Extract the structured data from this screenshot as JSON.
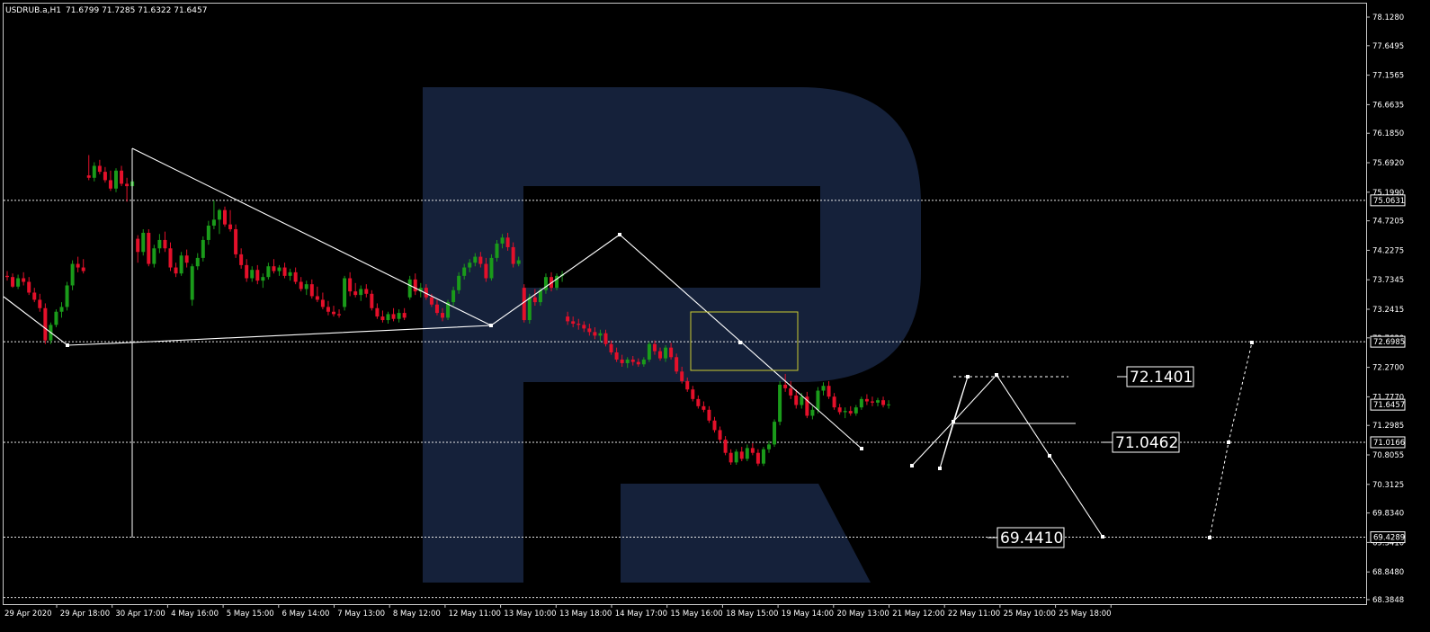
{
  "header": {
    "symbol": "USDRUB.a,H1",
    "ohlc": "71.6799 71.7285 71.6322 71.6457"
  },
  "colors": {
    "background": "#000000",
    "bull": "#1a9b1a",
    "bear": "#e4102a",
    "wave": "#ffffff",
    "zone": "#cccc33",
    "logo": "#15213a"
  },
  "chart_data": {
    "type": "candlestick",
    "symbol": "USDRUB.a",
    "timeframe": "H1",
    "grid": false,
    "ylim": [
      68.3848,
      78.128
    ],
    "y_ticks": [
      "78.1280",
      "77.6495",
      "77.1565",
      "76.6635",
      "76.1850",
      "75.6920",
      "75.1990",
      "74.7205",
      "74.2275",
      "73.7345",
      "73.2415",
      "72.7630",
      "72.2700",
      "71.7770",
      "71.2985",
      "70.8055",
      "70.3125",
      "69.8340",
      "69.3410",
      "68.8480",
      "68.3848"
    ],
    "x_ticks": [
      "29 Apr 2020",
      "29 Apr 18:00",
      "30 Apr 17:00",
      "4 May 16:00",
      "5 May 15:00",
      "6 May 14:00",
      "7 May 13:00",
      "8 May 12:00",
      "12 May 11:00",
      "13 May 10:00",
      "13 May 18:00",
      "14 May 17:00",
      "15 May 16:00",
      "18 May 15:00",
      "19 May 14:00",
      "20 May 13:00",
      "21 May 12:00",
      "22 May 11:00",
      "25 May 10:00",
      "25 May 18:00"
    ],
    "highlight_levels": [
      "75.0631",
      "72.6985",
      "71.6457",
      "71.0166",
      "69.4289"
    ],
    "targets": [
      "72.1401",
      "71.0462",
      "69.4410"
    ],
    "candles": [
      {
        "o": 73.8,
        "h": 73.88,
        "l": 73.72,
        "c": 73.78
      },
      {
        "o": 73.78,
        "h": 73.84,
        "l": 73.6,
        "c": 73.62
      },
      {
        "o": 73.62,
        "h": 73.82,
        "l": 73.58,
        "c": 73.76
      },
      {
        "o": 73.76,
        "h": 73.86,
        "l": 73.64,
        "c": 73.7
      },
      {
        "o": 73.7,
        "h": 73.78,
        "l": 73.48,
        "c": 73.52
      },
      {
        "o": 73.52,
        "h": 73.6,
        "l": 73.36,
        "c": 73.4
      },
      {
        "o": 73.4,
        "h": 73.5,
        "l": 73.2,
        "c": 73.26
      },
      {
        "o": 73.26,
        "h": 73.34,
        "l": 72.66,
        "c": 72.72
      },
      {
        "o": 72.72,
        "h": 73.02,
        "l": 72.66,
        "c": 72.98
      },
      {
        "o": 72.98,
        "h": 73.24,
        "l": 72.94,
        "c": 73.2
      },
      {
        "o": 73.2,
        "h": 73.36,
        "l": 73.1,
        "c": 73.28
      },
      {
        "o": 73.28,
        "h": 73.7,
        "l": 73.22,
        "c": 73.64
      },
      {
        "o": 73.64,
        "h": 74.06,
        "l": 73.56,
        "c": 74.0
      },
      {
        "o": 74.0,
        "h": 74.12,
        "l": 73.86,
        "c": 73.94
      },
      {
        "o": 73.94,
        "h": 74.08,
        "l": 73.84,
        "c": 73.88
      },
      {
        "o": 75.48,
        "h": 75.82,
        "l": 75.4,
        "c": 75.44
      },
      {
        "o": 75.44,
        "h": 75.7,
        "l": 75.38,
        "c": 75.64
      },
      {
        "o": 75.64,
        "h": 75.74,
        "l": 75.5,
        "c": 75.54
      },
      {
        "o": 75.54,
        "h": 75.62,
        "l": 75.36,
        "c": 75.4
      },
      {
        "o": 75.4,
        "h": 75.56,
        "l": 75.22,
        "c": 75.26
      },
      {
        "o": 75.26,
        "h": 75.6,
        "l": 75.2,
        "c": 75.56
      },
      {
        "o": 75.56,
        "h": 75.64,
        "l": 75.3,
        "c": 75.34
      },
      {
        "o": 75.34,
        "h": 75.44,
        "l": 75.04,
        "c": 75.3
      },
      {
        "o": 75.3,
        "h": 75.42,
        "l": 75.24,
        "c": 75.38
      },
      {
        "o": 74.42,
        "h": 74.48,
        "l": 74.02,
        "c": 74.2
      },
      {
        "o": 74.2,
        "h": 74.58,
        "l": 74.14,
        "c": 74.52
      },
      {
        "o": 74.52,
        "h": 74.58,
        "l": 73.96,
        "c": 74.0
      },
      {
        "o": 74.0,
        "h": 74.32,
        "l": 73.94,
        "c": 74.26
      },
      {
        "o": 74.26,
        "h": 74.5,
        "l": 74.18,
        "c": 74.4
      },
      {
        "o": 74.4,
        "h": 74.54,
        "l": 74.2,
        "c": 74.26
      },
      {
        "o": 74.26,
        "h": 74.36,
        "l": 73.88,
        "c": 73.94
      },
      {
        "o": 73.94,
        "h": 74.02,
        "l": 73.78,
        "c": 73.84
      },
      {
        "o": 73.84,
        "h": 74.2,
        "l": 73.8,
        "c": 74.14
      },
      {
        "o": 74.14,
        "h": 74.24,
        "l": 73.94,
        "c": 74.02
      },
      {
        "o": 73.4,
        "h": 74.0,
        "l": 73.3,
        "c": 73.96
      },
      {
        "o": 73.96,
        "h": 74.18,
        "l": 73.9,
        "c": 74.1
      },
      {
        "o": 74.1,
        "h": 74.46,
        "l": 74.04,
        "c": 74.4
      },
      {
        "o": 74.4,
        "h": 74.72,
        "l": 74.32,
        "c": 74.64
      },
      {
        "o": 74.64,
        "h": 75.06,
        "l": 74.58,
        "c": 74.74
      },
      {
        "o": 74.74,
        "h": 74.92,
        "l": 74.5,
        "c": 74.9
      },
      {
        "o": 74.9,
        "h": 74.96,
        "l": 74.62,
        "c": 74.66
      },
      {
        "o": 74.66,
        "h": 74.9,
        "l": 74.54,
        "c": 74.58
      },
      {
        "o": 74.58,
        "h": 74.66,
        "l": 74.1,
        "c": 74.16
      },
      {
        "o": 74.16,
        "h": 74.26,
        "l": 73.92,
        "c": 73.98
      },
      {
        "o": 73.98,
        "h": 74.08,
        "l": 73.7,
        "c": 73.76
      },
      {
        "o": 73.76,
        "h": 73.96,
        "l": 73.7,
        "c": 73.9
      },
      {
        "o": 73.9,
        "h": 73.98,
        "l": 73.66,
        "c": 73.72
      },
      {
        "o": 73.72,
        "h": 73.84,
        "l": 73.6,
        "c": 73.78
      },
      {
        "o": 73.78,
        "h": 74.02,
        "l": 73.74,
        "c": 73.96
      },
      {
        "o": 73.96,
        "h": 74.08,
        "l": 73.84,
        "c": 73.88
      },
      {
        "o": 73.88,
        "h": 73.98,
        "l": 73.8,
        "c": 73.94
      },
      {
        "o": 73.94,
        "h": 74.02,
        "l": 73.76,
        "c": 73.8
      },
      {
        "o": 73.8,
        "h": 73.92,
        "l": 73.72,
        "c": 73.86
      },
      {
        "o": 73.86,
        "h": 73.94,
        "l": 73.66,
        "c": 73.7
      },
      {
        "o": 73.7,
        "h": 73.78,
        "l": 73.54,
        "c": 73.58
      },
      {
        "o": 73.58,
        "h": 73.72,
        "l": 73.48,
        "c": 73.66
      },
      {
        "o": 73.66,
        "h": 73.74,
        "l": 73.42,
        "c": 73.46
      },
      {
        "o": 73.46,
        "h": 73.62,
        "l": 73.36,
        "c": 73.4
      },
      {
        "o": 73.4,
        "h": 73.52,
        "l": 73.24,
        "c": 73.28
      },
      {
        "o": 73.28,
        "h": 73.38,
        "l": 73.14,
        "c": 73.2
      },
      {
        "o": 73.2,
        "h": 73.3,
        "l": 73.12,
        "c": 73.16
      },
      {
        "o": 73.16,
        "h": 73.24,
        "l": 73.1,
        "c": 73.14
      },
      {
        "o": 73.28,
        "h": 73.8,
        "l": 73.22,
        "c": 73.76
      },
      {
        "o": 73.76,
        "h": 73.86,
        "l": 73.46,
        "c": 73.54
      },
      {
        "o": 73.54,
        "h": 73.68,
        "l": 73.44,
        "c": 73.48
      },
      {
        "o": 73.48,
        "h": 73.64,
        "l": 73.38,
        "c": 73.58
      },
      {
        "o": 73.58,
        "h": 73.66,
        "l": 73.44,
        "c": 73.5
      },
      {
        "o": 73.5,
        "h": 73.56,
        "l": 73.22,
        "c": 73.26
      },
      {
        "o": 73.26,
        "h": 73.34,
        "l": 73.08,
        "c": 73.12
      },
      {
        "o": 73.12,
        "h": 73.22,
        "l": 73.02,
        "c": 73.06
      },
      {
        "o": 73.06,
        "h": 73.2,
        "l": 73.0,
        "c": 73.16
      },
      {
        "o": 73.16,
        "h": 73.26,
        "l": 73.04,
        "c": 73.08
      },
      {
        "o": 73.08,
        "h": 73.24,
        "l": 73.02,
        "c": 73.18
      },
      {
        "o": 73.18,
        "h": 73.26,
        "l": 73.06,
        "c": 73.1
      },
      {
        "o": 73.44,
        "h": 73.8,
        "l": 73.4,
        "c": 73.74
      },
      {
        "o": 73.74,
        "h": 73.84,
        "l": 73.48,
        "c": 73.54
      },
      {
        "o": 73.54,
        "h": 73.68,
        "l": 73.44,
        "c": 73.6
      },
      {
        "o": 73.6,
        "h": 73.66,
        "l": 73.4,
        "c": 73.44
      },
      {
        "o": 73.44,
        "h": 73.5,
        "l": 73.28,
        "c": 73.32
      },
      {
        "o": 73.32,
        "h": 73.4,
        "l": 73.14,
        "c": 73.18
      },
      {
        "o": 73.18,
        "h": 73.26,
        "l": 73.04,
        "c": 73.1
      },
      {
        "o": 73.1,
        "h": 73.4,
        "l": 73.06,
        "c": 73.36
      },
      {
        "o": 73.36,
        "h": 73.62,
        "l": 73.3,
        "c": 73.56
      },
      {
        "o": 73.56,
        "h": 73.86,
        "l": 73.5,
        "c": 73.8
      },
      {
        "o": 73.8,
        "h": 74.0,
        "l": 73.74,
        "c": 73.94
      },
      {
        "o": 73.94,
        "h": 74.08,
        "l": 73.86,
        "c": 74.02
      },
      {
        "o": 74.02,
        "h": 74.18,
        "l": 73.96,
        "c": 74.12
      },
      {
        "o": 74.12,
        "h": 74.2,
        "l": 73.94,
        "c": 74.0
      },
      {
        "o": 74.0,
        "h": 74.1,
        "l": 73.7,
        "c": 73.76
      },
      {
        "o": 73.76,
        "h": 74.16,
        "l": 73.72,
        "c": 74.1
      },
      {
        "o": 74.1,
        "h": 74.4,
        "l": 74.04,
        "c": 74.34
      },
      {
        "o": 74.34,
        "h": 74.5,
        "l": 74.26,
        "c": 74.44
      },
      {
        "o": 74.44,
        "h": 74.52,
        "l": 74.22,
        "c": 74.28
      },
      {
        "o": 74.28,
        "h": 74.36,
        "l": 73.94,
        "c": 74.0
      },
      {
        "o": 74.0,
        "h": 74.12,
        "l": 73.96,
        "c": 74.06
      },
      {
        "o": 73.6,
        "h": 73.66,
        "l": 73.02,
        "c": 73.06
      },
      {
        "o": 73.06,
        "h": 73.5,
        "l": 73.0,
        "c": 73.44
      },
      {
        "o": 73.44,
        "h": 73.58,
        "l": 73.3,
        "c": 73.36
      },
      {
        "o": 73.36,
        "h": 73.6,
        "l": 73.3,
        "c": 73.56
      },
      {
        "o": 73.56,
        "h": 73.84,
        "l": 73.5,
        "c": 73.78
      },
      {
        "o": 73.78,
        "h": 73.86,
        "l": 73.54,
        "c": 73.6
      },
      {
        "o": 73.6,
        "h": 73.84,
        "l": 73.56,
        "c": 73.8
      },
      {
        "o": 73.8,
        "h": 73.88,
        "l": 73.7,
        "c": 73.82
      },
      {
        "o": 73.12,
        "h": 73.2,
        "l": 72.98,
        "c": 73.04
      },
      {
        "o": 73.04,
        "h": 73.12,
        "l": 72.94,
        "c": 73.0
      },
      {
        "o": 73.0,
        "h": 73.08,
        "l": 72.9,
        "c": 72.98
      },
      {
        "o": 72.98,
        "h": 73.04,
        "l": 72.86,
        "c": 72.92
      },
      {
        "o": 72.92,
        "h": 73.0,
        "l": 72.8,
        "c": 72.86
      },
      {
        "o": 72.86,
        "h": 72.94,
        "l": 72.74,
        "c": 72.8
      },
      {
        "o": 72.8,
        "h": 72.9,
        "l": 72.7,
        "c": 72.84
      },
      {
        "o": 72.84,
        "h": 72.9,
        "l": 72.62,
        "c": 72.66
      },
      {
        "o": 72.66,
        "h": 72.72,
        "l": 72.48,
        "c": 72.52
      },
      {
        "o": 72.52,
        "h": 72.6,
        "l": 72.36,
        "c": 72.4
      },
      {
        "o": 72.4,
        "h": 72.48,
        "l": 72.28,
        "c": 72.34
      },
      {
        "o": 72.34,
        "h": 72.44,
        "l": 72.26,
        "c": 72.4
      },
      {
        "o": 72.4,
        "h": 72.46,
        "l": 72.3,
        "c": 72.36
      },
      {
        "o": 72.36,
        "h": 72.42,
        "l": 72.28,
        "c": 72.32
      },
      {
        "o": 72.32,
        "h": 72.44,
        "l": 72.28,
        "c": 72.4
      },
      {
        "o": 72.4,
        "h": 72.7,
        "l": 72.36,
        "c": 72.66
      },
      {
        "o": 72.66,
        "h": 72.72,
        "l": 72.48,
        "c": 72.54
      },
      {
        "o": 72.54,
        "h": 72.6,
        "l": 72.38,
        "c": 72.42
      },
      {
        "o": 72.42,
        "h": 72.64,
        "l": 72.36,
        "c": 72.6
      },
      {
        "o": 72.6,
        "h": 72.68,
        "l": 72.4,
        "c": 72.44
      },
      {
        "o": 72.44,
        "h": 72.5,
        "l": 72.16,
        "c": 72.2
      },
      {
        "o": 72.2,
        "h": 72.28,
        "l": 72.0,
        "c": 72.04
      },
      {
        "o": 72.04,
        "h": 72.1,
        "l": 71.86,
        "c": 71.9
      },
      {
        "o": 71.9,
        "h": 71.96,
        "l": 71.7,
        "c": 71.74
      },
      {
        "o": 71.74,
        "h": 71.8,
        "l": 71.58,
        "c": 71.62
      },
      {
        "o": 71.62,
        "h": 71.7,
        "l": 71.52,
        "c": 71.56
      },
      {
        "o": 71.56,
        "h": 71.62,
        "l": 71.34,
        "c": 71.38
      },
      {
        "o": 71.38,
        "h": 71.44,
        "l": 71.18,
        "c": 71.22
      },
      {
        "o": 71.22,
        "h": 71.28,
        "l": 71.02,
        "c": 71.06
      },
      {
        "o": 71.06,
        "h": 71.12,
        "l": 70.8,
        "c": 70.84
      },
      {
        "o": 70.84,
        "h": 70.9,
        "l": 70.64,
        "c": 70.68
      },
      {
        "o": 70.68,
        "h": 70.9,
        "l": 70.64,
        "c": 70.86
      },
      {
        "o": 70.86,
        "h": 70.94,
        "l": 70.7,
        "c": 70.74
      },
      {
        "o": 70.74,
        "h": 70.98,
        "l": 70.7,
        "c": 70.92
      },
      {
        "o": 70.92,
        "h": 71.0,
        "l": 70.8,
        "c": 70.84
      },
      {
        "o": 70.84,
        "h": 70.9,
        "l": 70.62,
        "c": 70.66
      },
      {
        "o": 70.66,
        "h": 70.94,
        "l": 70.62,
        "c": 70.9
      },
      {
        "o": 70.9,
        "h": 71.04,
        "l": 70.84,
        "c": 70.98
      },
      {
        "o": 70.98,
        "h": 71.4,
        "l": 70.94,
        "c": 71.36
      },
      {
        "o": 71.36,
        "h": 72.04,
        "l": 71.3,
        "c": 71.98
      },
      {
        "o": 71.98,
        "h": 72.16,
        "l": 71.86,
        "c": 71.92
      },
      {
        "o": 71.92,
        "h": 72.04,
        "l": 71.74,
        "c": 71.8
      },
      {
        "o": 71.8,
        "h": 71.9,
        "l": 71.58,
        "c": 71.64
      },
      {
        "o": 71.64,
        "h": 71.84,
        "l": 71.58,
        "c": 71.78
      },
      {
        "o": 71.78,
        "h": 71.86,
        "l": 71.42,
        "c": 71.46
      },
      {
        "o": 71.46,
        "h": 71.62,
        "l": 71.4,
        "c": 71.56
      },
      {
        "o": 71.56,
        "h": 71.94,
        "l": 71.5,
        "c": 71.88
      },
      {
        "o": 71.88,
        "h": 72.02,
        "l": 71.8,
        "c": 71.96
      },
      {
        "o": 71.96,
        "h": 72.04,
        "l": 71.74,
        "c": 71.78
      },
      {
        "o": 71.78,
        "h": 71.84,
        "l": 71.56,
        "c": 71.6
      },
      {
        "o": 71.6,
        "h": 71.66,
        "l": 71.48,
        "c": 71.52
      },
      {
        "o": 71.52,
        "h": 71.6,
        "l": 71.42,
        "c": 71.54
      },
      {
        "o": 71.54,
        "h": 71.62,
        "l": 71.46,
        "c": 71.5
      },
      {
        "o": 71.5,
        "h": 71.64,
        "l": 71.46,
        "c": 71.6
      },
      {
        "o": 71.6,
        "h": 71.78,
        "l": 71.56,
        "c": 71.74
      },
      {
        "o": 71.74,
        "h": 71.82,
        "l": 71.64,
        "c": 71.7
      },
      {
        "o": 71.7,
        "h": 71.78,
        "l": 71.62,
        "c": 71.68
      },
      {
        "o": 71.68,
        "h": 71.76,
        "l": 71.62,
        "c": 71.72
      },
      {
        "o": 71.72,
        "h": 71.78,
        "l": 71.6,
        "c": 71.64
      },
      {
        "o": 71.64,
        "h": 71.72,
        "l": 71.58,
        "c": 71.65
      }
    ],
    "wave_path": [
      {
        "time": "29 Apr 2020",
        "value": 73.7
      },
      {
        "time": "29 Apr 18:00",
        "value": 72.68
      },
      {
        "time": "30 Apr 17:00",
        "value": 72.72
      },
      {
        "time": "12 May 11:00",
        "value": 73.06
      },
      {
        "time": "13 May 18:00",
        "value": 74.52
      },
      {
        "time": "18 May 15:00",
        "value": 72.72
      },
      {
        "time": "20 May 13:00",
        "value": 70.92
      },
      {
        "time": "21 May 12:00",
        "value": 70.62
      },
      {
        "time": "22 May 11:00",
        "value": 72.14
      },
      {
        "time": "25 May 18:00",
        "value": 69.44
      }
    ]
  }
}
